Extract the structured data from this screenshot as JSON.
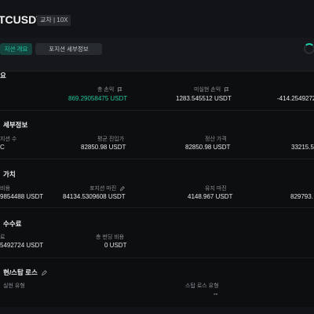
{
  "header": {
    "pair": "TCUSDT",
    "badge": "교차 | 10X"
  },
  "tabs": [
    {
      "label": "지션 개요"
    },
    {
      "label": "포지션 세부정보"
    }
  ],
  "sections": {
    "overview": {
      "title": "요",
      "total_pnl_label": "총 손익",
      "total_pnl_value": "869.29058475 USDT",
      "unrealized_label": "미실현 손익",
      "unrealized_value": "1283.545512 USDT",
      "third_value": "-414.2549272"
    },
    "details": {
      "title": "세부정보",
      "col1_label": "지션 수",
      "col1_value": "C",
      "avg_entry_label": "평균 진입가",
      "avg_entry_value": "82850.98 USDT",
      "settle_label": "정산 가격",
      "settle_value": "82850.98 USDT",
      "col4_value": "33215.5"
    },
    "value": {
      "title": "가치",
      "col1_label": "비용",
      "col1_value": "9854488 USDT",
      "margin_label": "포지션 마진",
      "margin_value": "84134.5309608 USDT",
      "maint_label": "유지 마진",
      "maint_value": "4148.967 USDT",
      "col4_value": "829793."
    },
    "fees": {
      "title": "수수료",
      "col1_label": "료",
      "col1_value": "5492724 USDT",
      "funding_label": "총 펀딩 비용",
      "funding_value": "0 USDT"
    },
    "tpsl": {
      "title": "현/스탑 로스",
      "col1_label": "실현 유형",
      "sl_label": "스탑 로스 유형",
      "sl_value": "--"
    }
  }
}
